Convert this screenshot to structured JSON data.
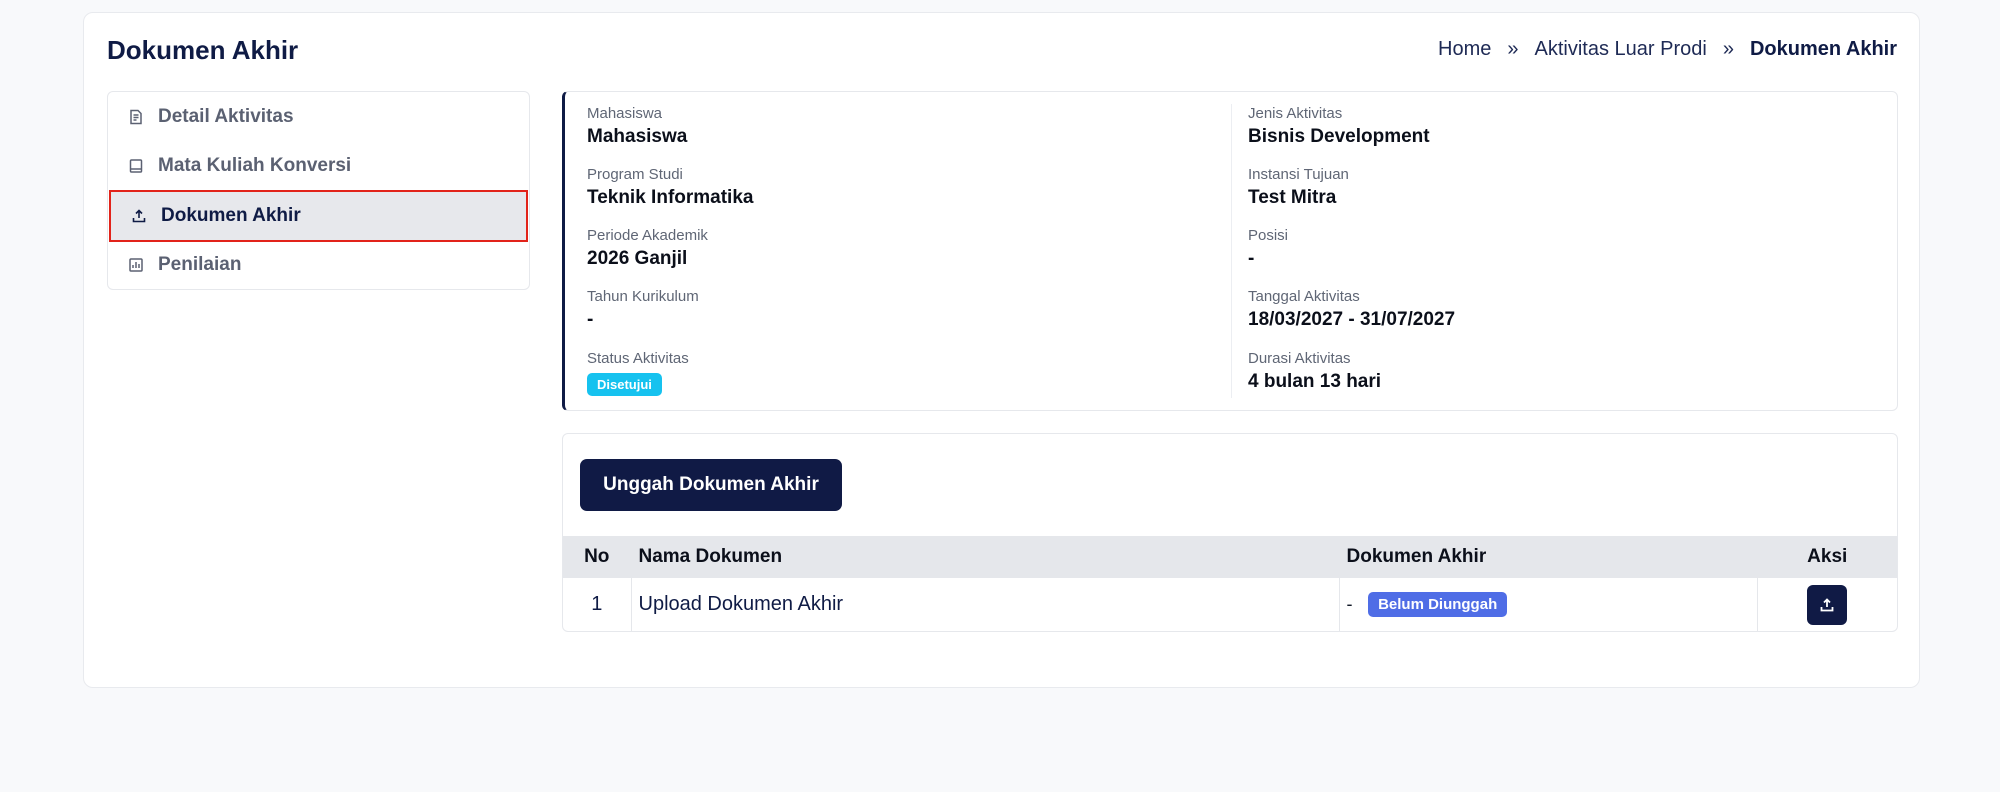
{
  "header": {
    "title": "Dokumen Akhir",
    "breadcrumb": [
      "Home",
      "Aktivitas Luar Prodi",
      "Dokumen Akhir"
    ]
  },
  "sidebar": {
    "items": [
      {
        "label": "Detail Aktivitas",
        "icon": "document-list-icon",
        "active": false
      },
      {
        "label": "Mata Kuliah Konversi",
        "icon": "book-icon",
        "active": false
      },
      {
        "label": "Dokumen Akhir",
        "icon": "upload-icon",
        "active": true
      },
      {
        "label": "Penilaian",
        "icon": "chart-icon",
        "active": false
      }
    ]
  },
  "info": {
    "left": [
      {
        "label": "Mahasiswa",
        "value": "Mahasiswa"
      },
      {
        "label": "Program Studi",
        "value": "Teknik Informatika"
      },
      {
        "label": "Periode Akademik",
        "value": "2026 Ganjil"
      },
      {
        "label": "Tahun Kurikulum",
        "value": "-"
      },
      {
        "label": "Status Aktivitas",
        "value": "Disetujui"
      }
    ],
    "right": [
      {
        "label": "Jenis Aktivitas",
        "value": "Bisnis Development"
      },
      {
        "label": "Instansi Tujuan",
        "value": "Test Mitra"
      },
      {
        "label": "Posisi",
        "value": "-"
      },
      {
        "label": "Tanggal Aktivitas",
        "value": "18/03/2027 - 31/07/2027"
      },
      {
        "label": "Durasi Aktivitas",
        "value": "4 bulan 13 hari"
      }
    ]
  },
  "documents": {
    "upload_label": "Unggah Dokumen Akhir",
    "columns": [
      "No",
      "Nama Dokumen",
      "Dokumen Akhir",
      "Aksi"
    ],
    "rows": [
      {
        "no": "1",
        "name": "Upload Dokumen Akhir",
        "file": "-",
        "status": "Belum Diunggah"
      }
    ]
  },
  "colors": {
    "primary": "#101a45",
    "active_outline": "#e2231a",
    "approved_badge": "#16c2ef",
    "pending_badge": "#4f6de6"
  }
}
